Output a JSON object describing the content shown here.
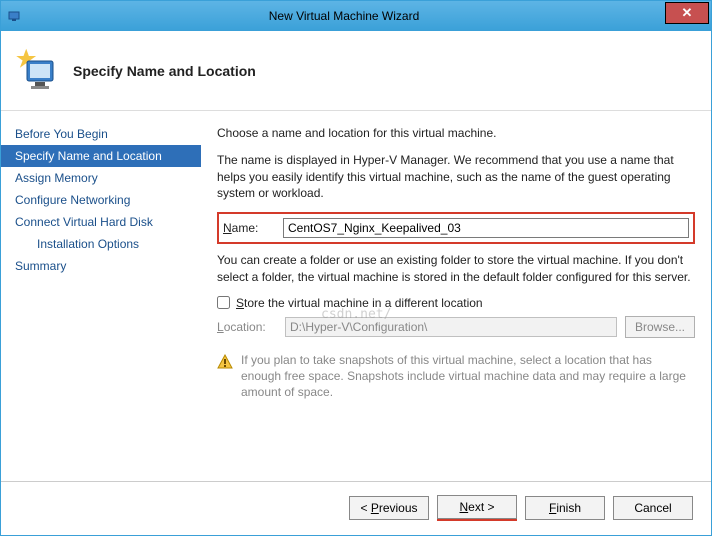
{
  "title": "New Virtual Machine Wizard",
  "header_title": "Specify Name and Location",
  "sidebar": {
    "steps": [
      "Before You Begin",
      "Specify Name and Location",
      "Assign Memory",
      "Configure Networking",
      "Connect Virtual Hard Disk",
      "Installation Options",
      "Summary"
    ],
    "active_index": 1
  },
  "content": {
    "intro": "Choose a name and location for this virtual machine.",
    "desc": "The name is displayed in Hyper-V Manager. We recommend that you use a name that helps you easily identify this virtual machine, such as the name of the guest operating system or workload.",
    "name_label": "Name:",
    "name_value": "CentOS7_Nginx_Keepalived_03",
    "folder_desc": "You can create a folder or use an existing folder to store the virtual machine. If you don't select a folder, the virtual machine is stored in the default folder configured for this server.",
    "store_checkbox": "Store the virtual machine in a different location",
    "location_label": "Location:",
    "location_value": "D:\\Hyper-V\\Configuration\\",
    "browse_label": "Browse...",
    "info": "If you plan to take snapshots of this virtual machine, select a location that has enough free space. Snapshots include virtual machine data and may require a large amount of space."
  },
  "footer": {
    "previous": "< Previous",
    "next": "Next >",
    "finish": "Finish",
    "cancel": "Cancel"
  },
  "watermark": "csdn.net/"
}
